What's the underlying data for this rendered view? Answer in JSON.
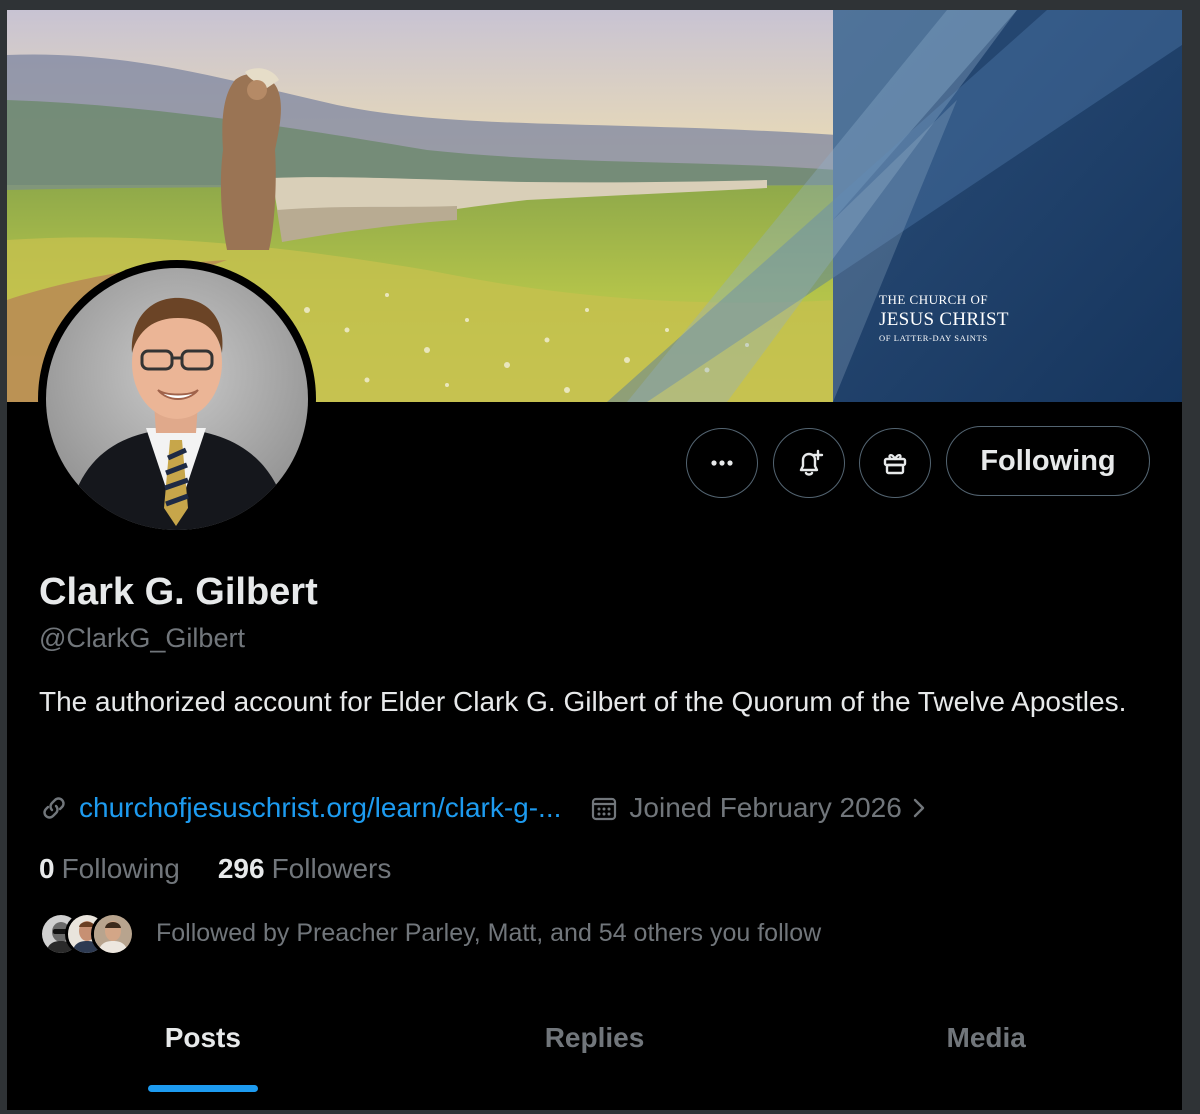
{
  "banner": {
    "logo_line1": "THE CHURCH OF",
    "logo_line2": "JESUS CHRIST",
    "logo_line3": "OF LATTER-DAY SAINTS"
  },
  "profile": {
    "name": "Clark G. Gilbert",
    "handle": "@ClarkG_Gilbert",
    "bio": "The authorized account for Elder Clark G. Gilbert of the Quorum of the Twelve Apostles.",
    "website": "churchofjesuschrist.org/learn/clark-g-...",
    "joined": "Joined February 2026"
  },
  "actions": {
    "more_icon": "more-horizontal-icon",
    "notify_icon": "bell-plus-icon",
    "gift_icon": "gift-icon",
    "follow_label": "Following"
  },
  "stats": {
    "following_count": "0",
    "following_label": "Following",
    "followers_count": "296",
    "followers_label": "Followers"
  },
  "followed_by": "Followed by Preacher Parley, Matt, and 54 others you follow",
  "tabs": [
    {
      "label": "Posts",
      "active": true
    },
    {
      "label": "Replies",
      "active": false
    },
    {
      "label": "Media",
      "active": false
    }
  ],
  "colors": {
    "accent": "#1d9bf0",
    "background": "#000000",
    "primary_text": "#e7e9ea",
    "secondary_text": "#71767b",
    "banner_blue": "#1f3e66"
  }
}
